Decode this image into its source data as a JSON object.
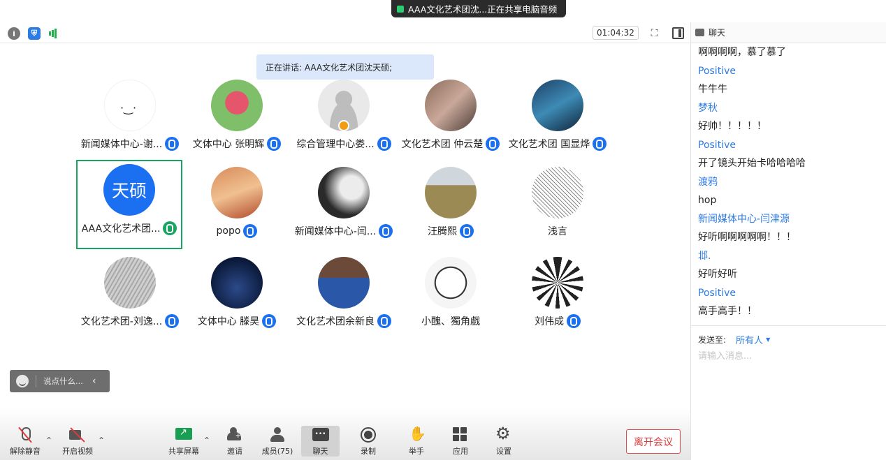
{
  "share_banner": {
    "text": "AAA文化艺术团沈...正在共享电脑音频"
  },
  "top_bar": {
    "timer": "01:04:32"
  },
  "speaking": {
    "text": "正在讲话: AAA文化艺术团沈天硕;"
  },
  "participants": [
    {
      "name": "新闻媒体中心-谢...",
      "avatar": "doodle",
      "mic": "on"
    },
    {
      "name": "文体中心 张明辉",
      "avatar": "baby",
      "mic": "on"
    },
    {
      "name": "综合管理中心娄...",
      "avatar": "default-user",
      "mic": "on"
    },
    {
      "name": "文化艺术团 仲云楚",
      "avatar": "cat",
      "mic": "on"
    },
    {
      "name": "文化艺术团 国显烨",
      "avatar": "painting",
      "mic": "on"
    },
    {
      "name": "AAA文化艺术团...",
      "avatar_text": "天硕",
      "mic": "talking"
    },
    {
      "name": "popo",
      "avatar": "sunset",
      "mic": "on"
    },
    {
      "name": "新闻媒体中心-闫...",
      "avatar": "silhouette",
      "mic": "on"
    },
    {
      "name": "汪腾熙",
      "avatar": "field",
      "mic": "on"
    },
    {
      "name": "浅言",
      "avatar": "sketch",
      "mic": "none"
    },
    {
      "name": "文化艺术团-刘逸...",
      "avatar": "stone",
      "mic": "on"
    },
    {
      "name": "文体中心 滕昊",
      "avatar": "night-sky",
      "mic": "on"
    },
    {
      "name": "文化艺术团余新良",
      "avatar": "athlete",
      "mic": "on"
    },
    {
      "name": "小醜、獨角戲",
      "avatar": "cartoon",
      "mic": "none"
    },
    {
      "name": "刘伟成",
      "avatar": "dragon",
      "mic": "on"
    }
  ],
  "reaction": {
    "placeholder": "说点什么..."
  },
  "toolbar": {
    "unmute": "解除静音",
    "start_video": "开启视频",
    "share_screen": "共享屏幕",
    "invite": "邀请",
    "members": "成员(75)",
    "chat": "聊天",
    "record": "录制",
    "raise_hand": "举手",
    "apps": "应用",
    "settings": "设置",
    "leave": "离开会议"
  },
  "chat": {
    "title": "聊天",
    "messages": [
      {
        "kind": "text",
        "value": "啊啊啊啊，慕了慕了"
      },
      {
        "kind": "sender",
        "value": "Positive"
      },
      {
        "kind": "text",
        "value": "牛牛牛"
      },
      {
        "kind": "sender",
        "value": "梦秋"
      },
      {
        "kind": "text",
        "value": "好帅！！！！！"
      },
      {
        "kind": "sender",
        "value": "Positive"
      },
      {
        "kind": "text",
        "value": "开了镜头开始卡哈哈哈哈"
      },
      {
        "kind": "sender",
        "value": "渡鸦"
      },
      {
        "kind": "text",
        "value": "hop"
      },
      {
        "kind": "sender",
        "value": "新闻媒体中心-闫津源"
      },
      {
        "kind": "text",
        "value": "好听啊啊啊啊啊！！！"
      },
      {
        "kind": "sender",
        "value": "邶."
      },
      {
        "kind": "text",
        "value": "好听好听"
      },
      {
        "kind": "sender",
        "value": "Positive"
      },
      {
        "kind": "text",
        "value": "高手高手！！"
      }
    ],
    "send_to_label": "发送至:",
    "recipient": "所有人",
    "input_placeholder": "请输入消息..."
  },
  "colors": {
    "accent": "#1b6ff1",
    "talking": "#1aa562",
    "leave": "#d93a3a",
    "sender": "#2d7be5"
  }
}
